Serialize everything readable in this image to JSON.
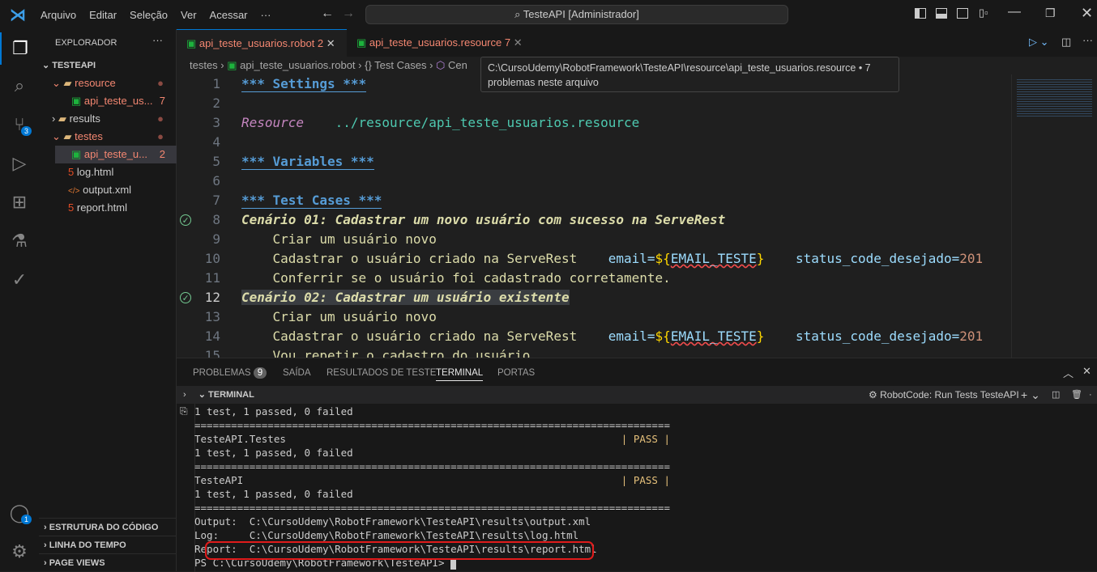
{
  "titlebar": {
    "menus": [
      "Arquivo",
      "Editar",
      "Seleção",
      "Ver",
      "Acessar",
      "···"
    ],
    "command_center": "TesteAPI [Administrador]"
  },
  "activity": {
    "source_control_badge": "3",
    "accounts_badge": "1"
  },
  "sidebar": {
    "title": "EXPLORADOR",
    "more": "···",
    "root": "TESTEAPI",
    "items": [
      {
        "label": "resource",
        "type": "folder",
        "color": "#f48771"
      },
      {
        "label": "api_teste_us...",
        "badge": "7",
        "type": "robot",
        "color": "#f48771"
      },
      {
        "label": "results",
        "type": "folder",
        "color": "#cccccc"
      },
      {
        "label": "testes",
        "type": "folder",
        "color": "#f48771"
      },
      {
        "label": "api_teste_u...",
        "badge": "2",
        "type": "robot",
        "color": "#f48771"
      },
      {
        "label": "log.html",
        "type": "html"
      },
      {
        "label": "output.xml",
        "type": "xml"
      },
      {
        "label": "report.html",
        "type": "html"
      }
    ],
    "sections": [
      "ESTRUTURA DO CÓDIGO",
      "LINHA DO TEMPO",
      "PAGE VIEWS"
    ]
  },
  "tabs": [
    {
      "label": "api_teste_usuarios.robot",
      "badge": "2",
      "active": true
    },
    {
      "label": "api_teste_usuarios.resource",
      "badge": "7",
      "active": false
    }
  ],
  "breadcrumb": [
    "testes",
    "api_teste_usuarios.robot",
    "{} Test Cases",
    "Cen"
  ],
  "tooltip": {
    "line1": "C:\\CursoUdemy\\RobotFramework\\TesteAPI\\resource\\api_teste_usuarios.resource • 7",
    "line2": "problemas neste arquivo"
  },
  "editor": {
    "lines": [
      {
        "n": "1",
        "settings": "*** Settings ***"
      },
      {
        "n": "2"
      },
      {
        "n": "3",
        "setting_key": "Resource",
        "setting_val": "../resource/api_teste_usuarios.resource"
      },
      {
        "n": "4"
      },
      {
        "n": "5",
        "settings": "*** Variables ***"
      },
      {
        "n": "6"
      },
      {
        "n": "7",
        "settings": "*** Test Cases ***"
      },
      {
        "n": "8",
        "testcase": "Cenário 01: Cadastrar um novo usuário com sucesso na ServeRest"
      },
      {
        "n": "9",
        "keyword": "Criar um usuário novo"
      },
      {
        "n": "10",
        "keyword": "Cadastrar o usuário criado na ServeRest",
        "a1": "email=",
        "v": "EMAIL_TESTE",
        "a2": "status_code_desejado=",
        "num": "201"
      },
      {
        "n": "11",
        "keyword": "Conferrir se o usuário foi cadastrado corretamente."
      },
      {
        "n": "12",
        "testcase": "Cenário 02: Cadastrar um usuário existente"
      },
      {
        "n": "13",
        "keyword": "Criar um usuário novo"
      },
      {
        "n": "14",
        "keyword": "Cadastrar o usuário criado na ServeRest",
        "a1": "email=",
        "v": "EMAIL_TESTE",
        "a2": "status_code_desejado=",
        "num": "201"
      },
      {
        "n": "15",
        "keyword": "Vou repetir o cadastro do usuário"
      }
    ]
  },
  "panel": {
    "tabs": [
      "PROBLEMAS",
      "SAÍDA",
      "RESULTADOS DE TESTE",
      "TERMINAL",
      "PORTAS"
    ],
    "problems_count": "9",
    "terminal_header": "TERMINAL",
    "task": "RobotCode: Run Tests TesteAPI"
  },
  "terminal": {
    "lines": [
      "1 test, 1 passed, 0 failed",
      "==============================================================================",
      "TesteAPI.Testes                                                       | PASS |",
      "1 test, 1 passed, 0 failed",
      "==============================================================================",
      "TesteAPI                                                              | PASS |",
      "1 test, 1 passed, 0 failed",
      "==============================================================================",
      "Output:  C:\\CursoUdemy\\RobotFramework\\TesteAPI\\results\\output.xml",
      "Log:     C:\\CursoUdemy\\RobotFramework\\TesteAPI\\results\\log.html",
      "Report:  C:\\CursoUdemy\\RobotFramework\\TesteAPI\\results\\report.html",
      "PS C:\\CursoUdemy\\RobotFramework\\TesteAPI> "
    ]
  }
}
